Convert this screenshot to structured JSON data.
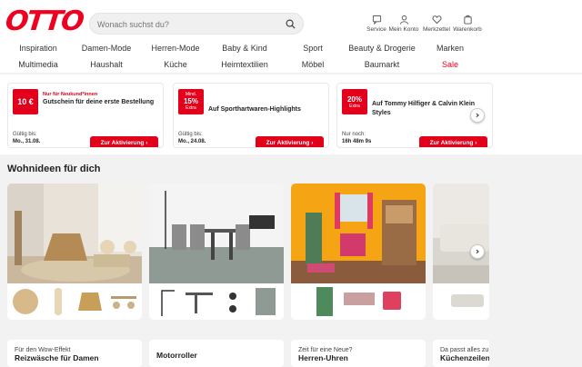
{
  "header": {
    "logo": "OTTO",
    "search_placeholder": "Wonach suchst du?",
    "service": "Service",
    "account": "Mein Konto",
    "wishlist": "Merkzettel",
    "cart": "Warenkorb"
  },
  "nav": {
    "row1": [
      "Inspiration",
      "Damen-Mode",
      "Herren-Mode",
      "Baby & Kind",
      "Sport",
      "Beauty & Drogerie",
      "Marken"
    ],
    "row2": [
      "Multimedia",
      "Haushalt",
      "Küche",
      "Heimtextilien",
      "Möbel",
      "Baumarkt",
      "Sale"
    ]
  },
  "coupons": [
    {
      "badge": "10 €",
      "tag": "Nur für Neukund*innen",
      "title": "Gutschein für deine erste Bestellung",
      "valid_label": "Gültig bis:",
      "valid_value": "Mo., 31.08.",
      "button": "Zur Aktivierung"
    },
    {
      "badge_top": "Mind.",
      "badge": "15%",
      "badge_bottom": "Extra",
      "title": "Auf Sporthartwaren-Highlights",
      "valid_label": "Gültig bis:",
      "valid_value": "Mo., 24.08.",
      "button": "Zur Aktivierung"
    },
    {
      "badge": "20%",
      "badge_bottom": "Extra",
      "title": "Auf Tommy Hilfiger & Calvin Klein Styles",
      "valid_label": "Nur noch:",
      "valid_value": "16h 48m 9s",
      "button": "Zur Aktivierung"
    }
  ],
  "section": {
    "title": "Wohnideen für dich"
  },
  "bottom_cards": [
    {
      "kicker": "Für den Wow-Effekt",
      "title": "Reizwäsche für Damen"
    },
    {
      "kicker": "",
      "title": "Motorroller"
    },
    {
      "kicker": "Zeit für eine Neue?",
      "title": "Herren-Uhren"
    },
    {
      "kicker": "Da passt alles zu",
      "title": "Küchenzeilen"
    }
  ],
  "colors": {
    "brand": "#f00020",
    "accent": "#e2001a"
  }
}
